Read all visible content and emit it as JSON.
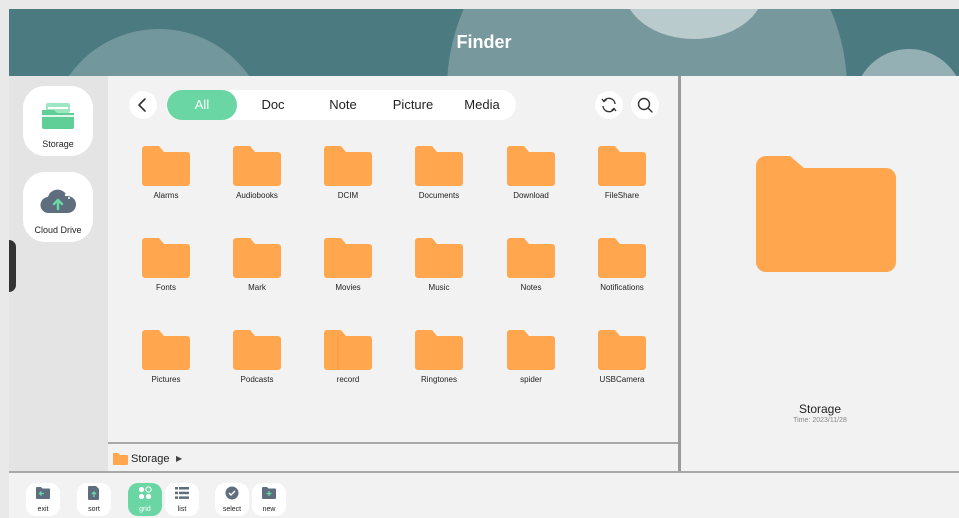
{
  "header": {
    "title": "Finder"
  },
  "sidebar": {
    "items": [
      {
        "label": "Storage",
        "icon": "storage-folder-icon"
      },
      {
        "label": "Cloud Drive",
        "icon": "cloud-upload-icon"
      }
    ]
  },
  "tabs": [
    "All",
    "Doc",
    "Note",
    "Picture",
    "Media"
  ],
  "active_tab": "All",
  "folders": [
    "Alarms",
    "Audiobooks",
    "DCIM",
    "Documents",
    "Download",
    "FileShare",
    "Fonts",
    "Mark",
    "Movies",
    "Music",
    "Notes",
    "Notifications",
    "Pictures",
    "Podcasts",
    "record",
    "Ringtones",
    "spider",
    "USBCamera"
  ],
  "path": {
    "label": "Storage"
  },
  "preview": {
    "name": "Storage",
    "time": "Time: 2023/11/28"
  },
  "toolbar": {
    "buttons": [
      {
        "label": "exit",
        "icon": "exit-icon"
      },
      {
        "label": "sort",
        "icon": "sort-icon"
      },
      {
        "label": "grid",
        "icon": "grid-icon"
      },
      {
        "label": "list",
        "icon": "list-icon"
      },
      {
        "label": "select",
        "icon": "select-check-icon"
      },
      {
        "label": "new",
        "icon": "new-folder-icon"
      }
    ]
  },
  "colors": {
    "header_bg": "#4b7a80",
    "accent_green": "#6ad6a3",
    "folder_orange": "#ffa64f",
    "icon_slate": "#5f6e7e"
  }
}
